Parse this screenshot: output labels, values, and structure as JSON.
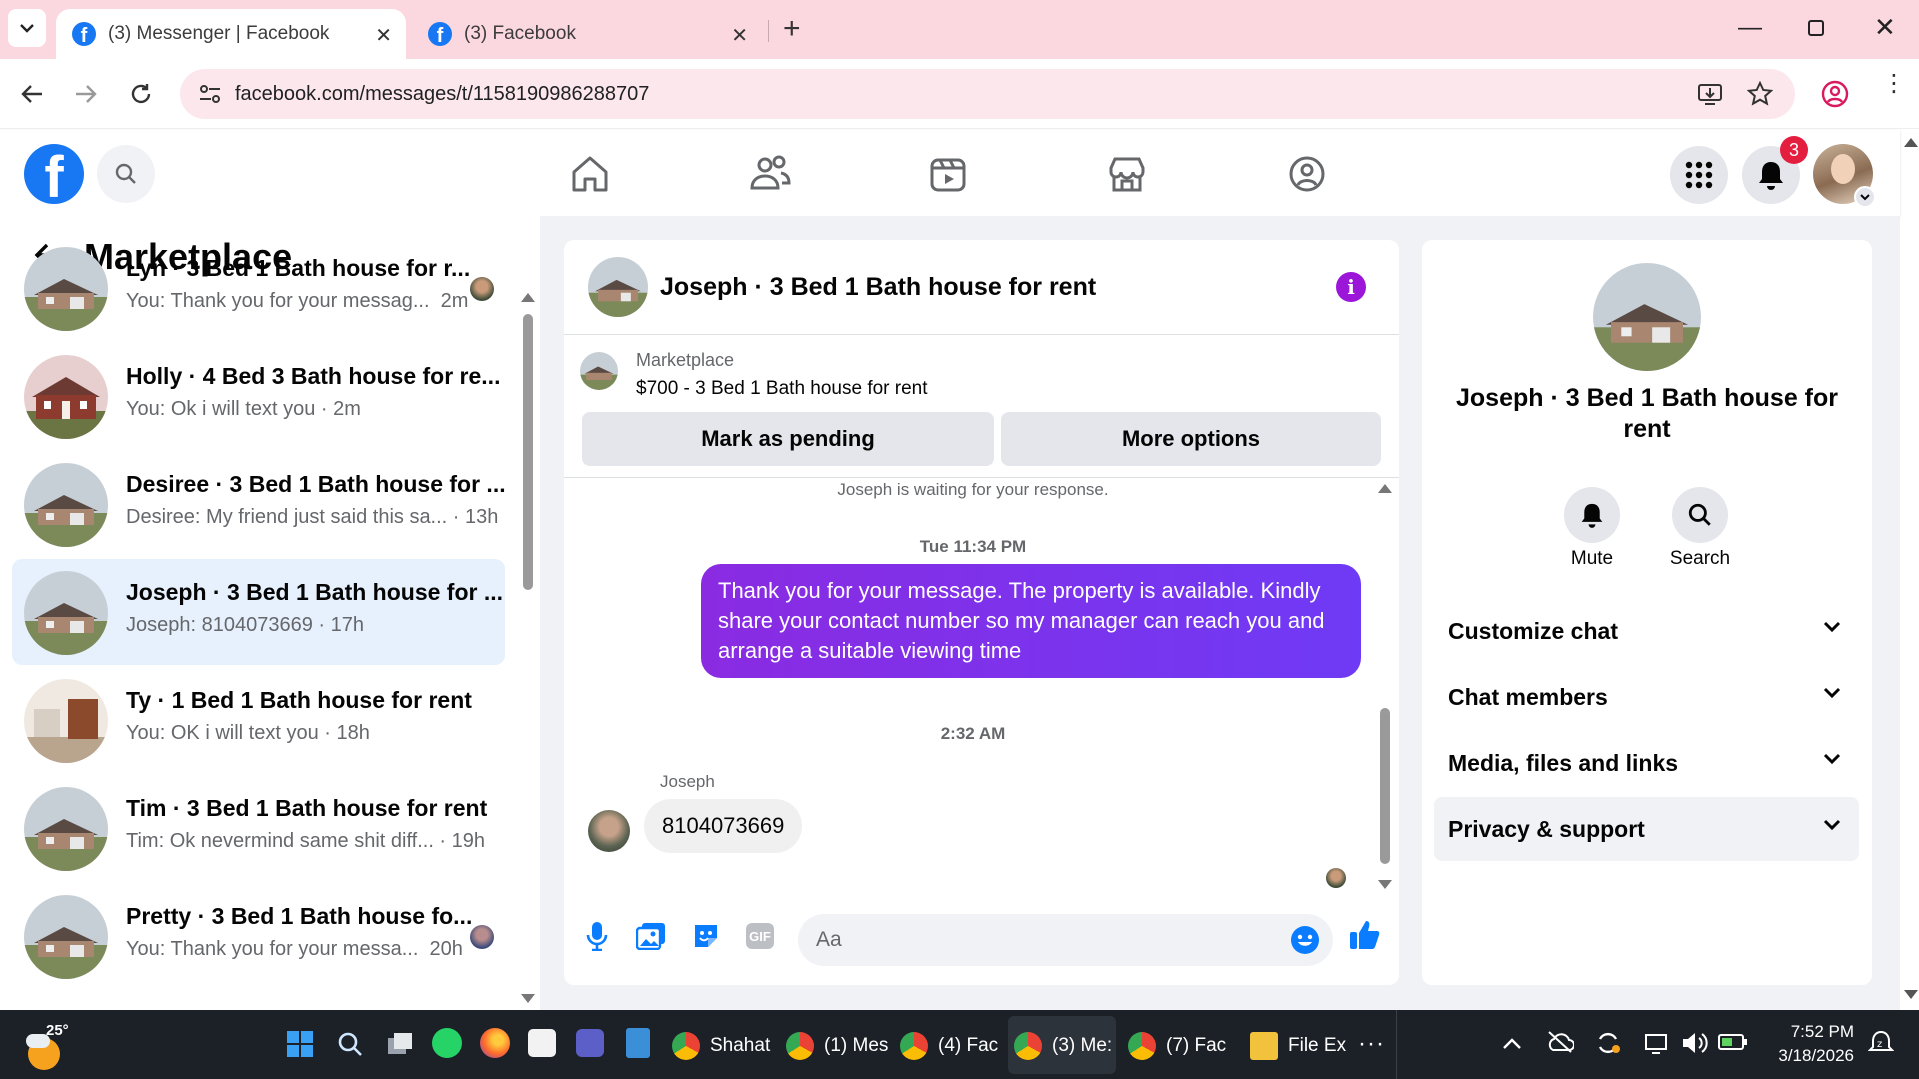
{
  "browser": {
    "tabs": [
      {
        "title": "(3) Messenger | Facebook",
        "active": true
      },
      {
        "title": "(3) Facebook",
        "active": false
      }
    ],
    "url": "facebook.com/messages/t/1158190986288707"
  },
  "fb": {
    "notification_count": "3"
  },
  "sidebar": {
    "title": "Marketplace",
    "conversations": [
      {
        "title": "Lyn · 3 Bed 1 Bath house for r...",
        "snippet": "You: Thank you for your messag...",
        "time": "2m"
      },
      {
        "title": "Holly · 4 Bed 3 Bath house for re...",
        "snippet": "You: Ok i will text you",
        "time": "2m"
      },
      {
        "title": "Desiree · 3 Bed 1 Bath house for ...",
        "snippet": "Desiree: My friend just said this sa...",
        "time": "13h"
      },
      {
        "title": "Joseph · 3 Bed 1 Bath house for ...",
        "snippet": "Joseph: 8104073669",
        "time": "17h",
        "selected": true
      },
      {
        "title": "Ty · 1 Bed 1 Bath house for rent",
        "snippet": "You: OK i will text you",
        "time": "18h"
      },
      {
        "title": "Tim · 3 Bed 1 Bath house for rent",
        "snippet": "Tim: Ok nevermind same shit diff...",
        "time": "19h"
      },
      {
        "title": "Pretty · 3 Bed 1 Bath house fo...",
        "snippet": "You: Thank you for your messa...",
        "time": "20h"
      }
    ]
  },
  "chat": {
    "header_title": "Joseph · 3 Bed 1 Bath house for rent",
    "listing_label": "Marketplace",
    "listing_title": "$700 - 3 Bed 1 Bath house for rent",
    "mark_pending_label": "Mark as pending",
    "more_options_label": "More options",
    "waiting_notice": "Joseph is waiting for your response.",
    "timestamp1": "Tue 11:34 PM",
    "outgoing_message": "Thank you for your message. The property is available. Kindly share your contact number so my manager can reach you and arrange a suitable viewing time",
    "timestamp2": "2:32 AM",
    "sender_name": "Joseph",
    "incoming_message": "8104073669",
    "input_placeholder": "Aa"
  },
  "details": {
    "name": "Joseph · 3 Bed 1 Bath house for rent",
    "mute_label": "Mute",
    "search_label": "Search",
    "sections": [
      "Customize chat",
      "Chat members",
      "Media, files and links",
      "Privacy & support"
    ]
  },
  "taskbar": {
    "weather_temp": "25°",
    "apps": [
      "Shahat",
      "(1) Mes",
      "(4) Fac",
      "(3) Me:",
      "(7) Fac",
      "File Ex"
    ],
    "time": "7:52 PM",
    "date": "3/18/2026"
  },
  "colors": {
    "fb_blue": "#1877f2",
    "messenger_purple": "#8a2be2",
    "tab_bar": "#fbd7e0",
    "selected_row": "#e7f1fd"
  }
}
